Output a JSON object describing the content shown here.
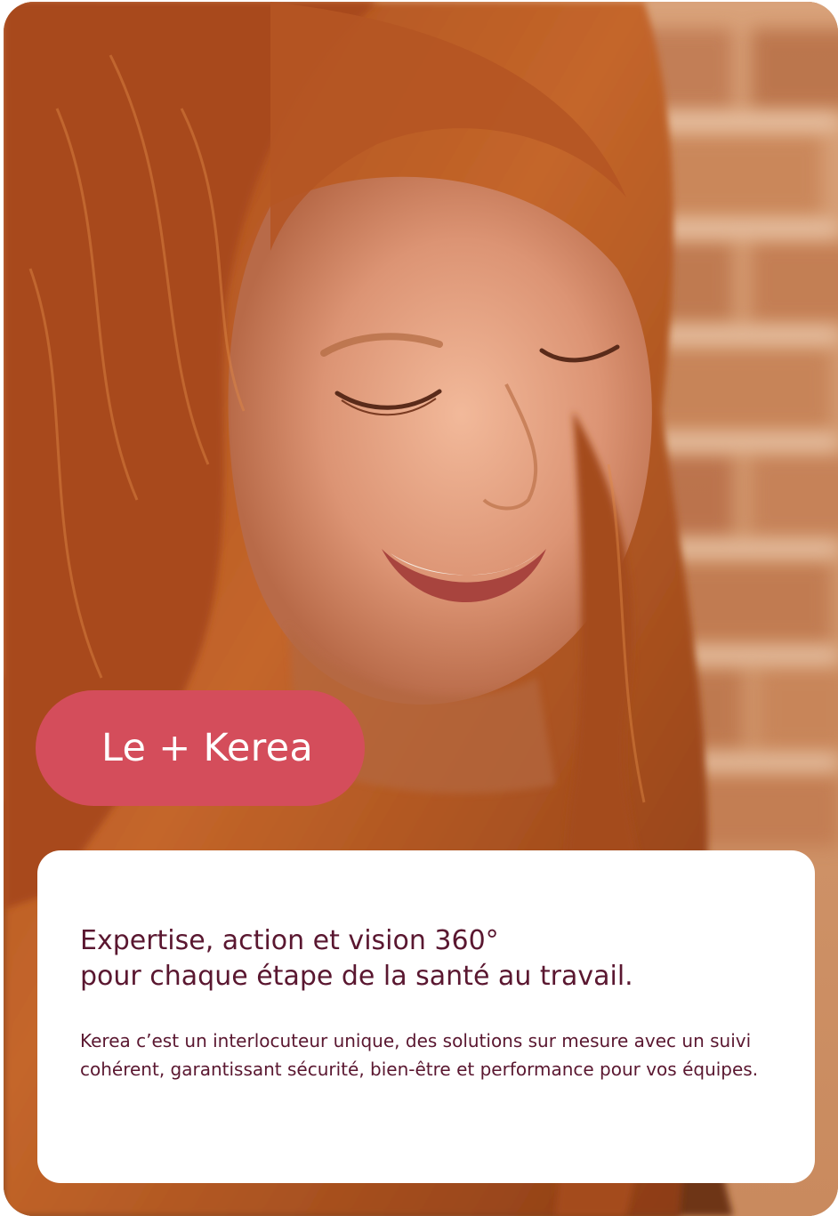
{
  "badge": {
    "label": "Le + Kerea"
  },
  "info": {
    "headline_line1": "Expertise, action et vision 360°",
    "headline_line2": "pour chaque étape de la santé au travail.",
    "body": "Kerea c’est un interlocuteur unique, des solutions sur mesure avec un suivi cohérent, garantissant sécurité, bien-être et performance pour vos équipes."
  },
  "colors": {
    "badge": "#d44d5b",
    "text": "#5a1730",
    "panel": "#ffffff"
  },
  "image": {
    "subject": "photo of a smiling red-haired woman in front of a brick wall"
  }
}
